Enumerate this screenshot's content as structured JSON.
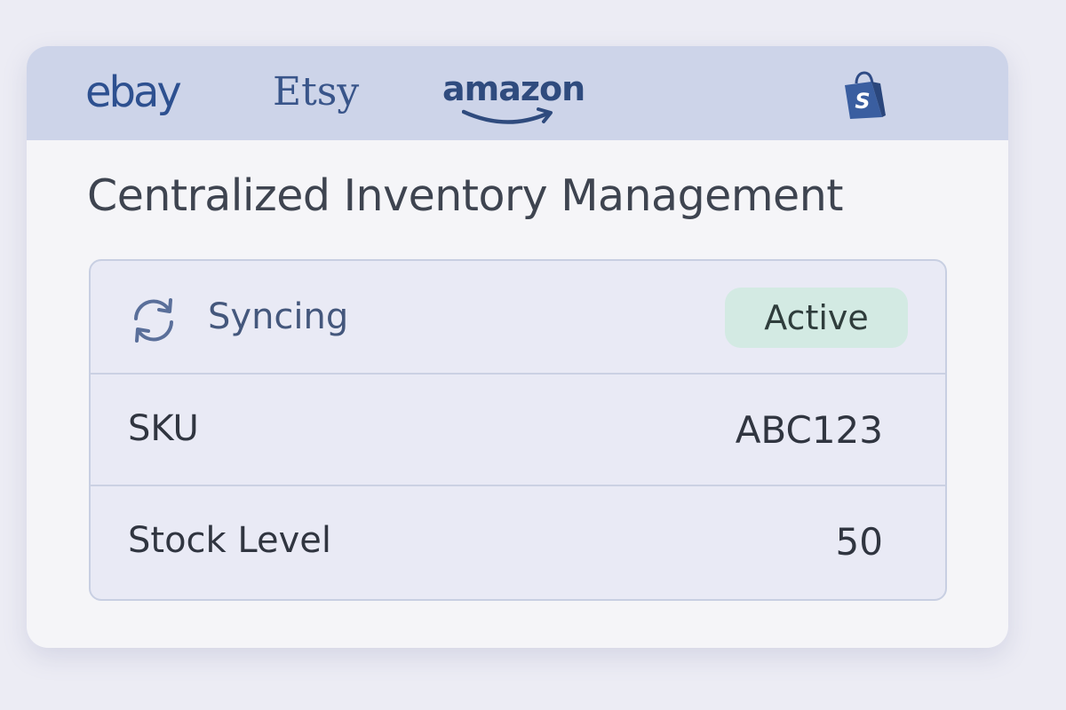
{
  "header": {
    "logos": [
      {
        "label": "ebay",
        "icon": "ebay-logo"
      },
      {
        "label": "Etsy",
        "icon": "etsy-logo"
      },
      {
        "label": "amazon",
        "icon": "amazon-logo"
      },
      {
        "label": "",
        "icon": "shopify-bag-icon"
      }
    ]
  },
  "main": {
    "title": "Centralized Inventory Management",
    "sync": {
      "icon": "sync-icon",
      "label": "Syncing",
      "status": "Active"
    },
    "rows": [
      {
        "label": "SKU",
        "value": "ABC123"
      },
      {
        "label": "Stock Level",
        "value": "50"
      }
    ]
  },
  "colors": {
    "header_bg": "#cdd4e9",
    "brand_blue": "#2f4f86",
    "badge_bg": "#d3eae3",
    "card_bg": "#f5f5f8",
    "panel_bg": "#e9eaf5"
  }
}
